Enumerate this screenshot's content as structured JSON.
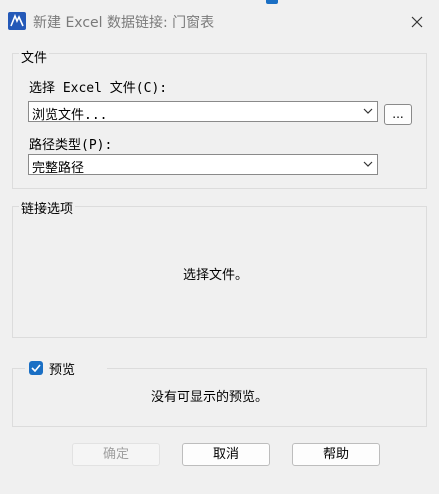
{
  "window": {
    "title": "新建 Excel 数据链接: 门窗表"
  },
  "file_group": {
    "label": "文件",
    "select_label": "选择 Excel 文件(C):",
    "select_value": "浏览文件...",
    "browse_label": "...",
    "path_type_label": "路径类型(P):",
    "path_type_value": "完整路径"
  },
  "link_options": {
    "label": "链接选项",
    "message": "选择文件。"
  },
  "preview": {
    "label": "预览",
    "checked": true,
    "message": "没有可显示的预览。"
  },
  "buttons": {
    "ok": "确定",
    "cancel": "取消",
    "help": "帮助"
  },
  "colors": {
    "accent": "#1a6fc4",
    "app_icon": "#2459b8",
    "background": "#f0f0f0"
  },
  "icons": {
    "app": "autocad-icon",
    "close": "close-icon",
    "dropdown": "chevron-down-icon",
    "check": "check-icon"
  }
}
